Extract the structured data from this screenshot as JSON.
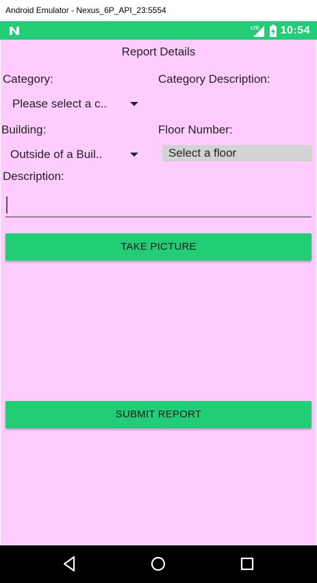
{
  "window": {
    "title": "Android Emulator - Nexus_6P_API_23:5554"
  },
  "statusbar": {
    "time": "10:54",
    "network": "LTE",
    "bg_color": "#21cd75"
  },
  "page": {
    "title": "Report Details",
    "bg_color": "#ffccff"
  },
  "form": {
    "category_label": "Category:",
    "category_value": "Please select a c..",
    "category_description_label": "Category Description:",
    "building_label": "Building:",
    "building_value": "Outside of a Buil..",
    "floor_label": "Floor Number:",
    "floor_button": "Select a floor",
    "description_label": "Description:",
    "description_value": ""
  },
  "buttons": {
    "take_picture": "TAKE PICTURE",
    "submit_report": "SUBMIT REPORT",
    "accent_color": "#21cd75"
  },
  "navbar": {
    "icons": [
      "back-icon",
      "home-icon",
      "recents-icon"
    ]
  }
}
